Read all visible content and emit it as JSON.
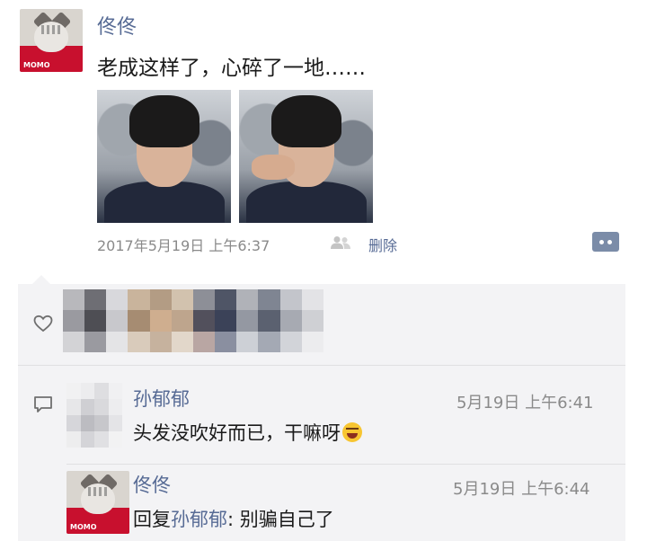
{
  "post": {
    "author": "佟佟",
    "avatar_brand": "MOMO",
    "text": "老成这样了，心碎了一地……",
    "timestamp": "2017年5月19日 上午6:37",
    "delete_label": "删除",
    "photos": [
      "photo-1",
      "photo-2"
    ]
  },
  "comments": [
    {
      "author": "孙郁郁",
      "time": "5月19日 上午6:41",
      "text": "头发没吹好而已，干嘛呀"
    },
    {
      "author": "佟佟",
      "time": "5月19日 上午6:44",
      "reply_prefix": "回复",
      "reply_to": "孙郁郁",
      "text": ": 别骗自己了"
    }
  ],
  "colors": {
    "name_link": "#576b95",
    "panel_bg": "#f3f3f5",
    "meta_gray": "#8a8a8a"
  },
  "icons": [
    "friends-icon",
    "comment-button-icon",
    "like-heart-icon",
    "comment-bubble-icon",
    "grimace-emoji-icon"
  ]
}
